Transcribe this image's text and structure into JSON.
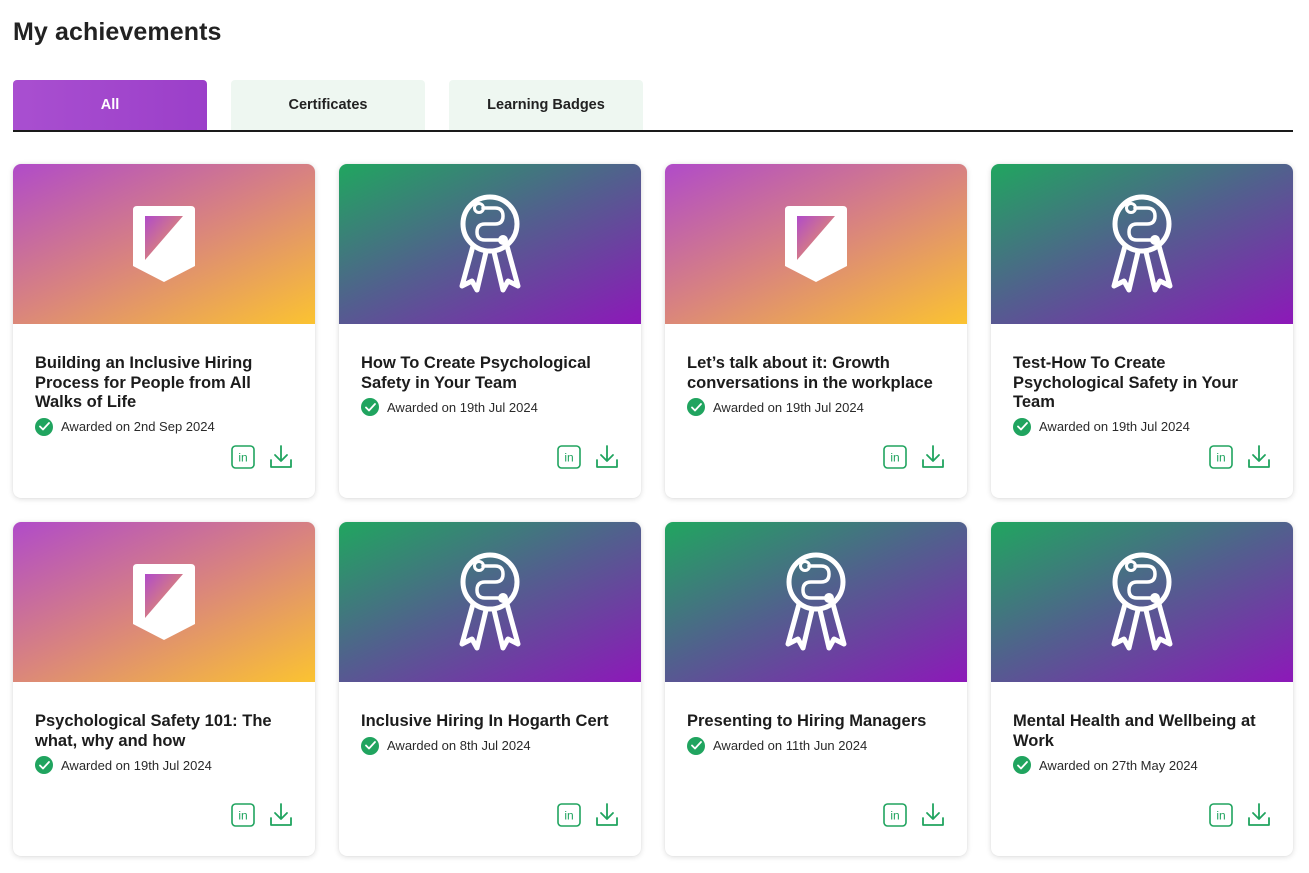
{
  "page": {
    "title": "My achievements"
  },
  "tabs": [
    {
      "label": "All",
      "active": true
    },
    {
      "label": "Certificates",
      "active": false
    },
    {
      "label": "Learning Badges",
      "active": false
    }
  ],
  "colors": {
    "accent": "#a94fd0",
    "success": "#20a45f",
    "tab_bg": "#eef7f1"
  },
  "cards": [
    {
      "kind": "badge",
      "icon": "shield-icon",
      "title": "Building an Inclusive Hiring Process for People from All Walks of Life",
      "awarded": "Awarded on 2nd Sep 2024"
    },
    {
      "kind": "certificate",
      "icon": "ribbon-icon",
      "title": "How To Create Psychological Safety in Your Team",
      "awarded": "Awarded on 19th Jul 2024"
    },
    {
      "kind": "badge",
      "icon": "shield-icon",
      "title": "Let’s talk about it: Growth conversations in the workplace",
      "awarded": "Awarded on 19th Jul 2024"
    },
    {
      "kind": "certificate",
      "icon": "ribbon-icon",
      "title": "Test-How To Create Psychological Safety in Your Team",
      "awarded": "Awarded on 19th Jul 2024"
    },
    {
      "kind": "badge",
      "icon": "shield-icon",
      "title": "Psychological Safety 101: The what, why and how",
      "awarded": "Awarded on 19th Jul 2024"
    },
    {
      "kind": "certificate",
      "icon": "ribbon-icon",
      "title": "Inclusive Hiring In Hogarth Cert",
      "awarded": "Awarded on 8th Jul 2024"
    },
    {
      "kind": "certificate",
      "icon": "ribbon-icon",
      "title": "Presenting to Hiring Managers",
      "awarded": "Awarded on 11th Jun 2024"
    },
    {
      "kind": "certificate",
      "icon": "ribbon-icon",
      "title": "Mental Health and Wellbeing at Work",
      "awarded": "Awarded on 27th May 2024"
    }
  ]
}
